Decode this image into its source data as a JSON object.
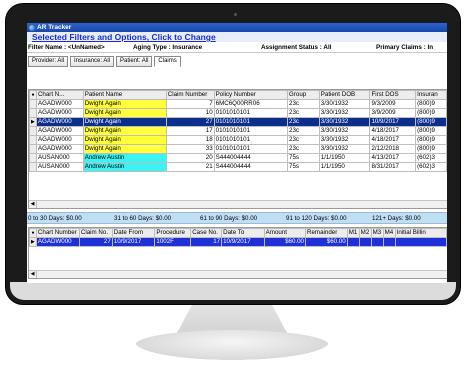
{
  "window": {
    "title": "AR Tracker"
  },
  "filters": {
    "link_text": "Selected Filters and Options, Click to Change",
    "filter_name": "Filter Name : <UnNamed>",
    "aging_type": "Aging Type : Insurance",
    "assignment_status": "Assignment Status : All",
    "primary_claims": "Primary Claims : In"
  },
  "tabs": [
    "Provider: All",
    "Insurance: All",
    "Patient: All",
    "Claims"
  ],
  "claims_table": {
    "columns": [
      "",
      "Chart N...",
      "Patient Name",
      "Claim Number",
      "Policy Number",
      "Group",
      "Patient DOB",
      "First DOS",
      "Insuran"
    ],
    "rows": [
      {
        "chart": "AGADW000",
        "patient": "Dwight Again",
        "claim": "7",
        "policy": "6MC6Q00RR06",
        "group": "23c",
        "dob": "3/30/1932",
        "dos": "9/3/2009",
        "ins": "(800)9"
      },
      {
        "chart": "AGADW000",
        "patient": "Dwight Again",
        "claim": "10",
        "policy": "0101010101",
        "group": "23c",
        "dob": "3/30/1932",
        "dos": "3/9/2009",
        "ins": "(800)9"
      },
      {
        "chart": "AGADW000",
        "patient": "Dwight Again",
        "claim": "27",
        "policy": "0101010101",
        "group": "23c",
        "dob": "3/30/1932",
        "dos": "10/9/2017",
        "ins": "(800)9"
      },
      {
        "chart": "AGADW000",
        "patient": "Dwight Again",
        "claim": "17",
        "policy": "0101010101",
        "group": "23c",
        "dob": "3/30/1932",
        "dos": "4/18/2017",
        "ins": "(800)9"
      },
      {
        "chart": "AGADW000",
        "patient": "Dwight Again",
        "claim": "18",
        "policy": "0101010101",
        "group": "23c",
        "dob": "3/30/1932",
        "dos": "4/18/2017",
        "ins": "(800)9"
      },
      {
        "chart": "AGADW000",
        "patient": "Dwight Again",
        "claim": "33",
        "policy": "0101010101",
        "group": "23c",
        "dob": "3/30/1932",
        "dos": "2/12/2018",
        "ins": "(800)9"
      },
      {
        "chart": "AUSAN000",
        "patient": "Andrew Austin",
        "claim": "20",
        "policy": "S444004444",
        "group": "75s",
        "dob": "1/1/1950",
        "dos": "4/13/2017",
        "ins": "(602)3"
      },
      {
        "chart": "AUSAN000",
        "patient": "Andrew Austin",
        "claim": "21",
        "policy": "S444004444",
        "group": "75s",
        "dob": "1/1/1950",
        "dos": "8/31/2017",
        "ins": "(602)3"
      }
    ]
  },
  "aging": [
    "0 to 30 Days: $0.00",
    "31 to 60 Days: $0.00",
    "61 to 90 Days: $0.00",
    "91 to 120 Days: $0.00",
    "121+ Days: $0.00"
  ],
  "detail_table": {
    "columns": [
      "",
      "Chart Number",
      "Claim No.",
      "Date From",
      "Procedure",
      "Case No.",
      "Date To",
      "Amount",
      "Remainder",
      "M1",
      "M2",
      "M3",
      "M4",
      "Initial Billin"
    ],
    "rows": [
      {
        "chart": "AGADW000",
        "claim": "27",
        "from": "10/9/2017",
        "proc": "1002F",
        "case": "17",
        "to": "10/9/2017",
        "amount": "$60.00",
        "remainder": "$60.00",
        "m1": "",
        "m2": "",
        "m3": "",
        "m4": "",
        "billing": ""
      }
    ]
  },
  "colors": {
    "yellow_row": "#ffff3c",
    "cyan_row": "#3cf2f2",
    "selected_row": "#0c2f8c",
    "detail_row": "#1e31d6",
    "aging_bar": "#bfe0f4"
  }
}
